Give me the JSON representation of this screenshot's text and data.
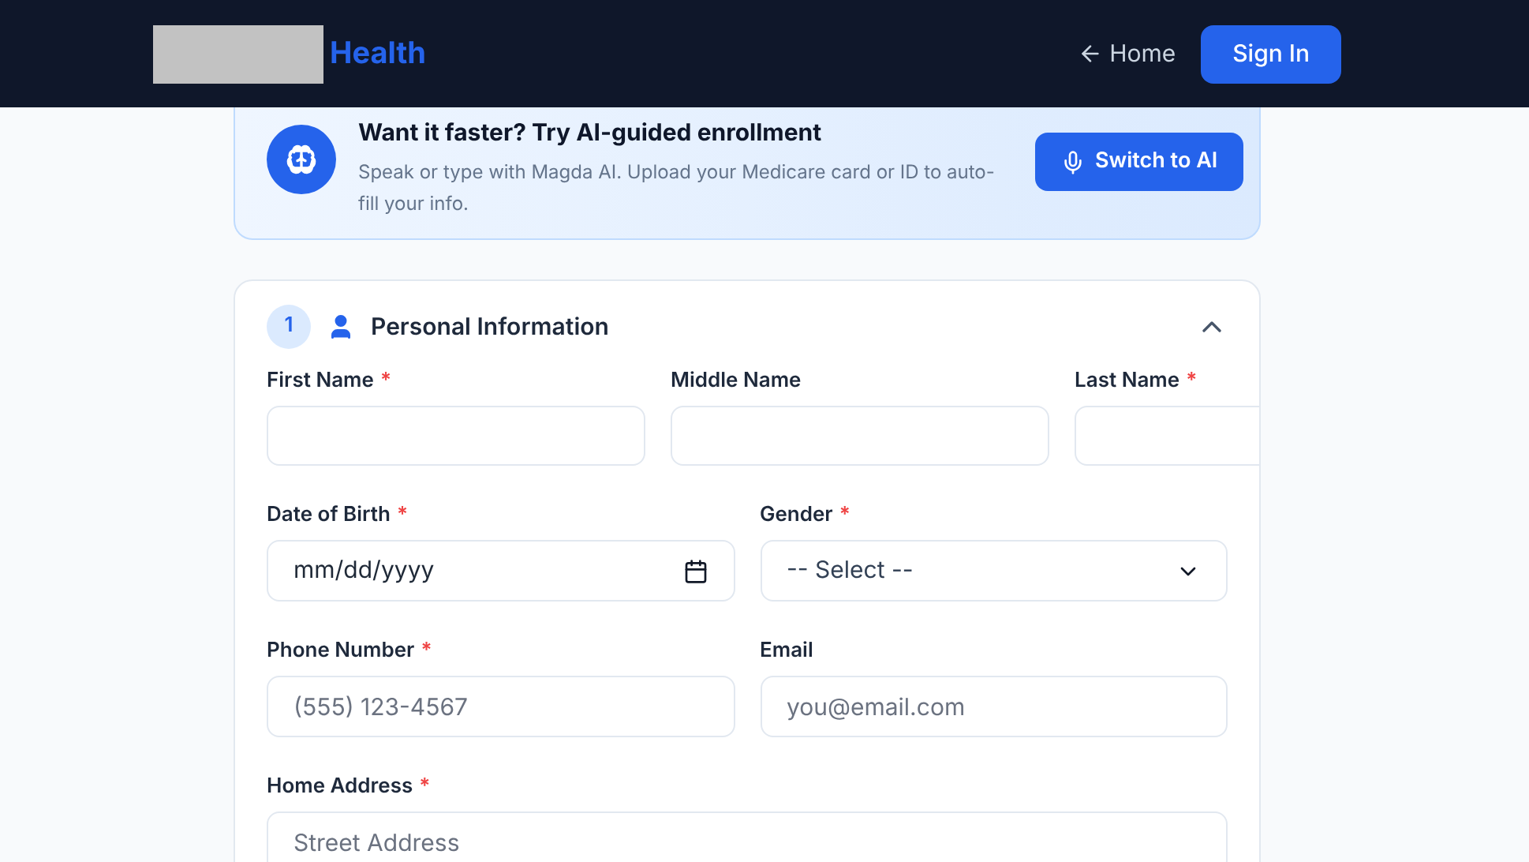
{
  "header": {
    "brand": "Health",
    "nav_link": "Home",
    "sign_in": "Sign In"
  },
  "banner": {
    "title": "Want it faster? Try AI-guided enrollment",
    "text": "Speak or type with Magda AI. Upload your Medicare card or ID to auto-fill your info.",
    "button": "Switch to AI"
  },
  "section": {
    "step": "1",
    "title": "Personal Information",
    "expanded": true,
    "rows": [
      [
        {
          "kind": "text",
          "label": "First Name",
          "required_mark": "*"
        },
        {
          "kind": "text",
          "label": "Middle Name"
        },
        {
          "kind": "text",
          "label": "Last Name",
          "required_mark": "*"
        }
      ],
      [
        {
          "kind": "date",
          "label": "Date of Birth",
          "required_mark": "*",
          "placeholder": "mm/dd/yyyy"
        },
        {
          "kind": "select",
          "label": "Gender",
          "required_mark": "*",
          "value": "-- Select --"
        }
      ],
      [
        {
          "kind": "text",
          "label": "Phone Number",
          "required_mark": "*",
          "placeholder": "(555) 123-4567"
        },
        {
          "kind": "text",
          "label": "Email",
          "placeholder": "you@email.com"
        }
      ],
      [
        {
          "kind": "text",
          "label": "Home Address",
          "required_mark": "*",
          "placeholder": "Street Address"
        }
      ]
    ]
  }
}
